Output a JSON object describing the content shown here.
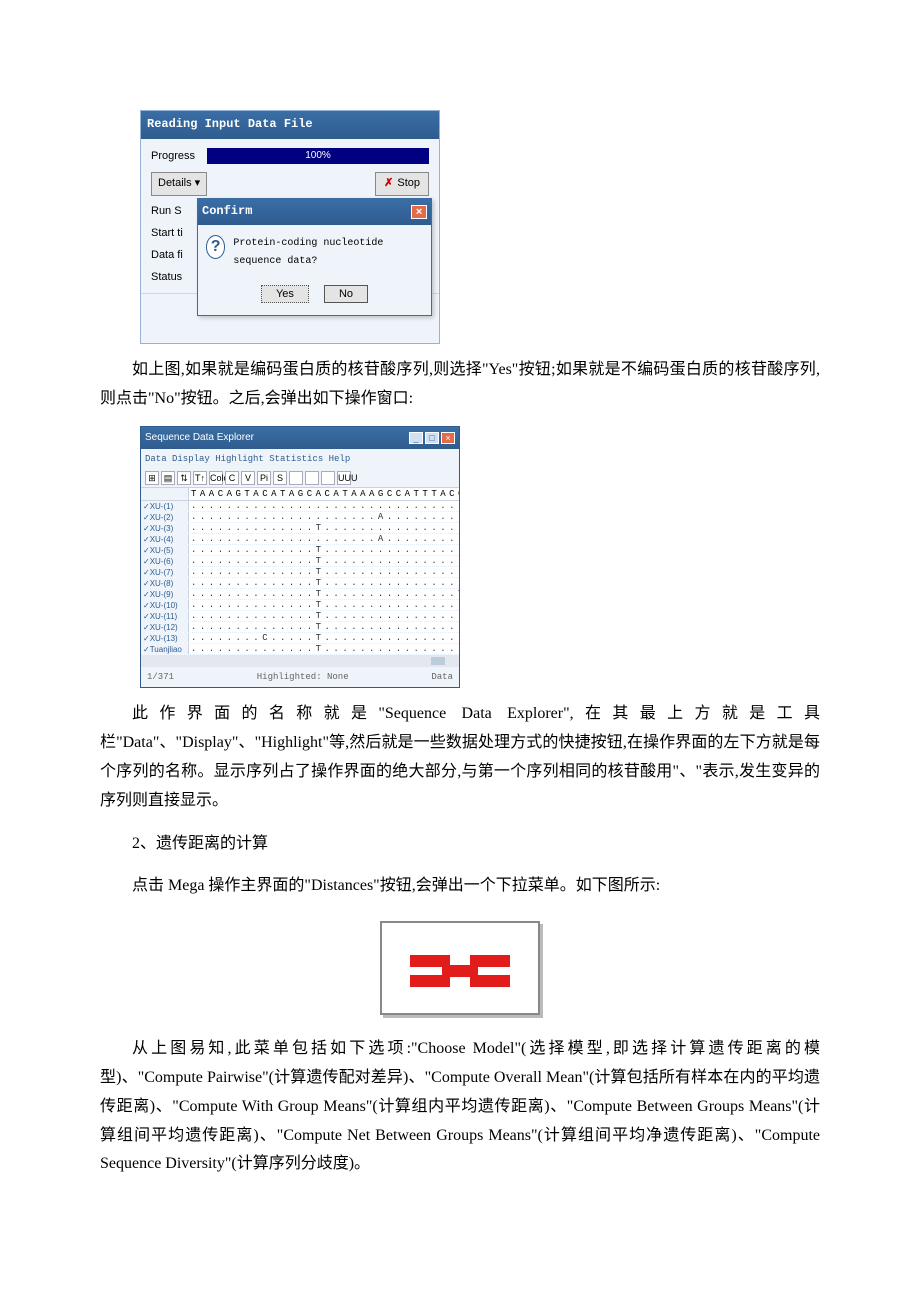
{
  "reading_dialog": {
    "title": "Reading Input Data File",
    "progress_label": "Progress",
    "progress_text": "100%",
    "details_label": "Details  ▾",
    "stop_label": "Stop",
    "fields": [
      "Run S",
      "Start ti",
      "Data fi",
      "Status"
    ]
  },
  "confirm_dialog": {
    "title": "Confirm",
    "message": "Protein-coding nucleotide sequence data?",
    "yes": "Yes",
    "no": "No"
  },
  "para1": "如上图,如果就是编码蛋白质的核苷酸序列,则选择\"Yes\"按钮;如果就是不编码蛋白质的核苷酸序列,则点击\"No\"按钮。之后,会弹出如下操作窗口:",
  "seq_explorer": {
    "title": "Sequence Data Explorer",
    "menu": "Data  Display  Highlight  Statistics  Help",
    "toolbar": [
      "⊞",
      "▤",
      "⇅",
      "T↑",
      "Color",
      "C",
      "V",
      "Pi",
      "S",
      " ",
      " ",
      " ",
      "UUU"
    ],
    "reference_seq": "TAACAGTACATAGCACATAAAGCCATTTACCGTACATAC",
    "rows": [
      {
        "name": "✓XU-(1)",
        "data": "..........................................."
      },
      {
        "name": "✓XU-(2)",
        "data": ".....................A...................."
      },
      {
        "name": "✓XU-(3)",
        "data": "..............T..........................."
      },
      {
        "name": "✓XU-(4)",
        "data": ".....................A...................."
      },
      {
        "name": "✓XU-(5)",
        "data": "..............T..........................."
      },
      {
        "name": "✓XU-(6)",
        "data": "..............T..........................."
      },
      {
        "name": "✓XU-(7)",
        "data": "..............T..........................."
      },
      {
        "name": "✓XU-(8)",
        "data": "..............T..........................."
      },
      {
        "name": "✓XU-(9)",
        "data": "..............T...............T..........."
      },
      {
        "name": "✓XU-(10)",
        "data": "..............T..........................."
      },
      {
        "name": "✓XU-(11)",
        "data": "..............T..........................."
      },
      {
        "name": "✓XU-(12)",
        "data": "..............T..........................."
      },
      {
        "name": "✓XU-(13)",
        "data": "........C.....T..........................."
      },
      {
        "name": "✓Tuanjliao",
        "data": "..............T................T.........."
      }
    ],
    "footer_left": "1/371",
    "footer_mid": "Highlighted: None",
    "footer_right": "Data"
  },
  "para2": "此作界面的名称就是\"Sequence Data Explorer\",在其最上方就是工具栏\"Data\"、\"Display\"、\"Highlight\"等,然后就是一些数据处理方式的快捷按钮,在操作界面的左下方就是每个序列的名称。显示序列占了操作界面的绝大部分,与第一个序列相同的核苷酸用\"、\"表示,发生变异的序列则直接显示。",
  "section2": "2、遗传距离的计算",
  "para3": "点击 Mega 操作主界面的\"Distances\"按钮,会弹出一个下拉菜单。如下图所示:",
  "para4": "从上图易知,此菜单包括如下选项:\"Choose Model\"(选择模型,即选择计算遗传距离的模型)、\"Compute Pairwise\"(计算遗传配对差异)、\"Compute Overall Mean\"(计算包括所有样本在内的平均遗传距离)、\"Compute With Group Means\"(计算组内平均遗传距离)、\"Compute Between Groups Means\"(计算组间平均遗传距离)、\"Compute Net Between Groups Means\"(计算组间平均净遗传距离)、\"Compute Sequence Diversity\"(计算序列分歧度)。"
}
